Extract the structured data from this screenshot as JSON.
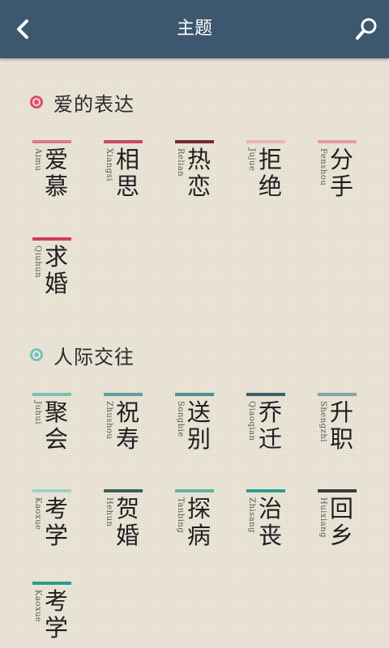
{
  "header": {
    "title": "主题",
    "back_icon": "chevron-left-icon",
    "search_icon": "search-icon"
  },
  "colors": {
    "header": "#3d576f",
    "background": "#ebe6d8"
  },
  "sections": [
    {
      "title": "爱的表达",
      "bullet_color": "#d9506a",
      "tiles": [
        {
          "pinyin": "Aimu",
          "hanzi": "爱慕",
          "color": "#d97a8c"
        },
        {
          "pinyin": "Xiangsi",
          "hanzi": "相思",
          "color": "#c6476a"
        },
        {
          "pinyin": "Relian",
          "hanzi": "热恋",
          "color": "#7a2636"
        },
        {
          "pinyin": "Jujue",
          "hanzi": "拒绝",
          "color": "#eab3bf"
        },
        {
          "pinyin": "Fenshou",
          "hanzi": "分手",
          "color": "#e99aab"
        },
        {
          "pinyin": "Qiuhun",
          "hanzi": "求婚",
          "color": "#d03c58"
        }
      ]
    },
    {
      "title": "人际交往",
      "bullet_color": "#7fbfb5",
      "tiles": [
        {
          "pinyin": "Juhui",
          "hanzi": "聚会",
          "color": "#7fbfb5"
        },
        {
          "pinyin": "Zhushou",
          "hanzi": "祝寿",
          "color": "#5f9fa0"
        },
        {
          "pinyin": "Songbie",
          "hanzi": "送别",
          "color": "#4f8f92"
        },
        {
          "pinyin": "Qiaoqian",
          "hanzi": "乔迁",
          "color": "#3f5d62"
        },
        {
          "pinyin": "Shengzhi",
          "hanzi": "升职",
          "color": "#8aa0a6"
        },
        {
          "pinyin": "Kaoxue",
          "hanzi": "考学",
          "color": "#9fd0c7"
        },
        {
          "pinyin": "Hehun",
          "hanzi": "贺婚",
          "color": "#3a5f5c"
        },
        {
          "pinyin": "Tanbing",
          "hanzi": "探病",
          "color": "#5fb5a4"
        },
        {
          "pinyin": "Zhisang",
          "hanzi": "治丧",
          "color": "#2f9b8c"
        },
        {
          "pinyin": "Huixiang",
          "hanzi": "回乡",
          "color": "#3a3a3a"
        },
        {
          "pinyin": "Kaoxue",
          "hanzi": "考学",
          "color": "#2f9b8c"
        }
      ]
    }
  ]
}
